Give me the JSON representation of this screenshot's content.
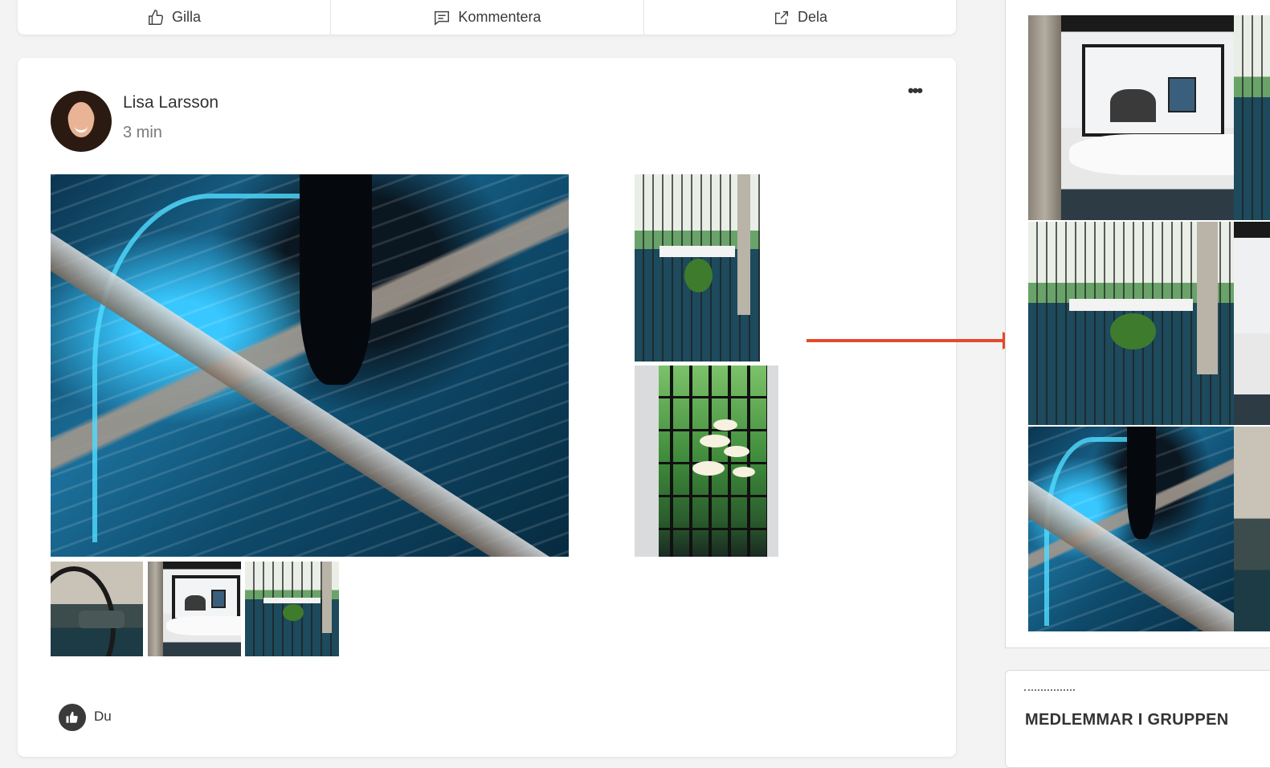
{
  "actions": {
    "like_label": "Gilla",
    "comment_label": "Kommentera",
    "share_label": "Dela"
  },
  "post": {
    "author": "Lisa Larsson",
    "time": "3 min",
    "more_label": "•••",
    "liked_by": "Du"
  },
  "sidebar": {
    "members_title": "MEDLEMMAR I GRUPPEN"
  },
  "colors": {
    "arrow": "#e34a2c",
    "like_badge": "#3a3a3a"
  }
}
